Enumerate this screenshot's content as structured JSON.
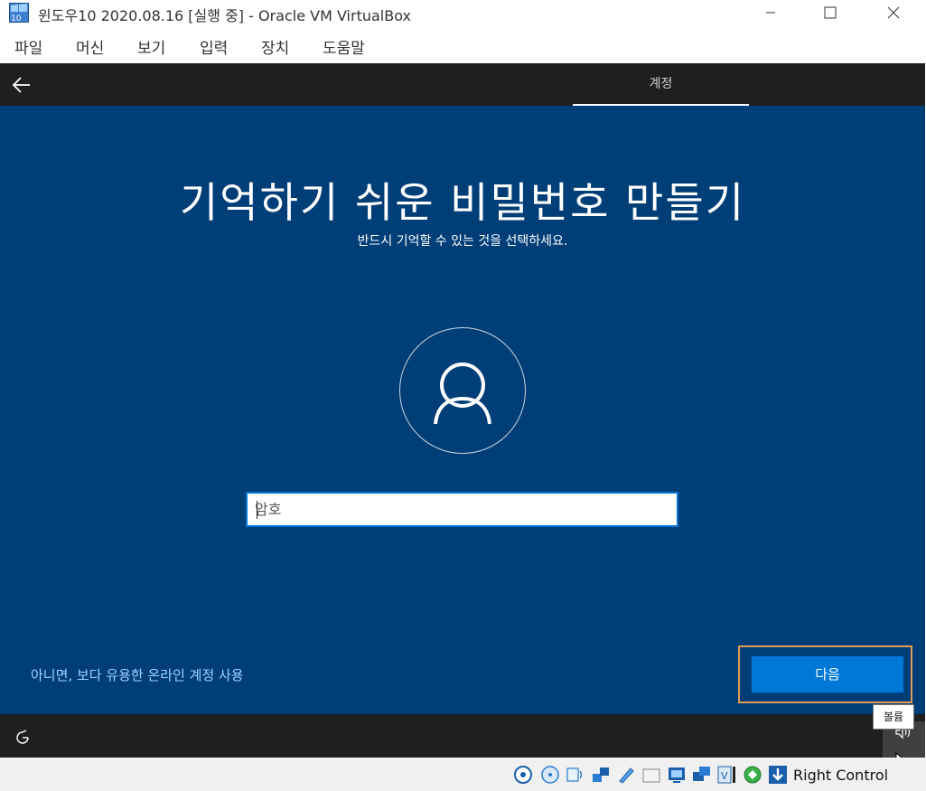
{
  "window": {
    "title": "윈도우10 2020.08.16 [실행 중] - Oracle VM VirtualBox",
    "app_icon": "virtualbox-windows10-icon"
  },
  "window_controls": {
    "minimize_icon": "minimize-icon",
    "maximize_icon": "maximize-icon",
    "close_icon": "close-icon"
  },
  "menu": {
    "items": [
      {
        "label": "파일"
      },
      {
        "label": "머신"
      },
      {
        "label": "보기"
      },
      {
        "label": "입력"
      },
      {
        "label": "장치"
      },
      {
        "label": "도움말"
      }
    ]
  },
  "oobe": {
    "header_tab": "계정",
    "back_icon": "arrow-left-icon",
    "title": "기억하기 쉬운 비밀번호 만들기",
    "subtitle": "반드시 기억할 수 있는 것을 선택하세요.",
    "avatar_icon": "user-icon",
    "password": {
      "placeholder": "암호",
      "value": ""
    },
    "online_account_link": "아니면, 보다 유용한 온라인 계정 사용",
    "next_button": "다음",
    "accessibility_icon": "accessibility-icon",
    "volume_icon": "volume-icon",
    "volume_tooltip": "볼륨"
  },
  "colors": {
    "oobe_background": "#003e78",
    "header_footer": "#1f1f1f",
    "accent_button": "#0078d7",
    "link": "#9fd1ff",
    "highlight_border": "#e09c5a"
  },
  "statusbar": {
    "icons": [
      "hard-disk-icon",
      "optical-drive-icon",
      "audio-icon",
      "network-icon",
      "usb-icon",
      "shared-folders-icon",
      "display-icon",
      "video-capture-icon",
      "virtualization-icon",
      "cpu-icon",
      "mouse-integration-icon",
      "keyboard-capture-icon"
    ],
    "host_key": "Right Control"
  }
}
